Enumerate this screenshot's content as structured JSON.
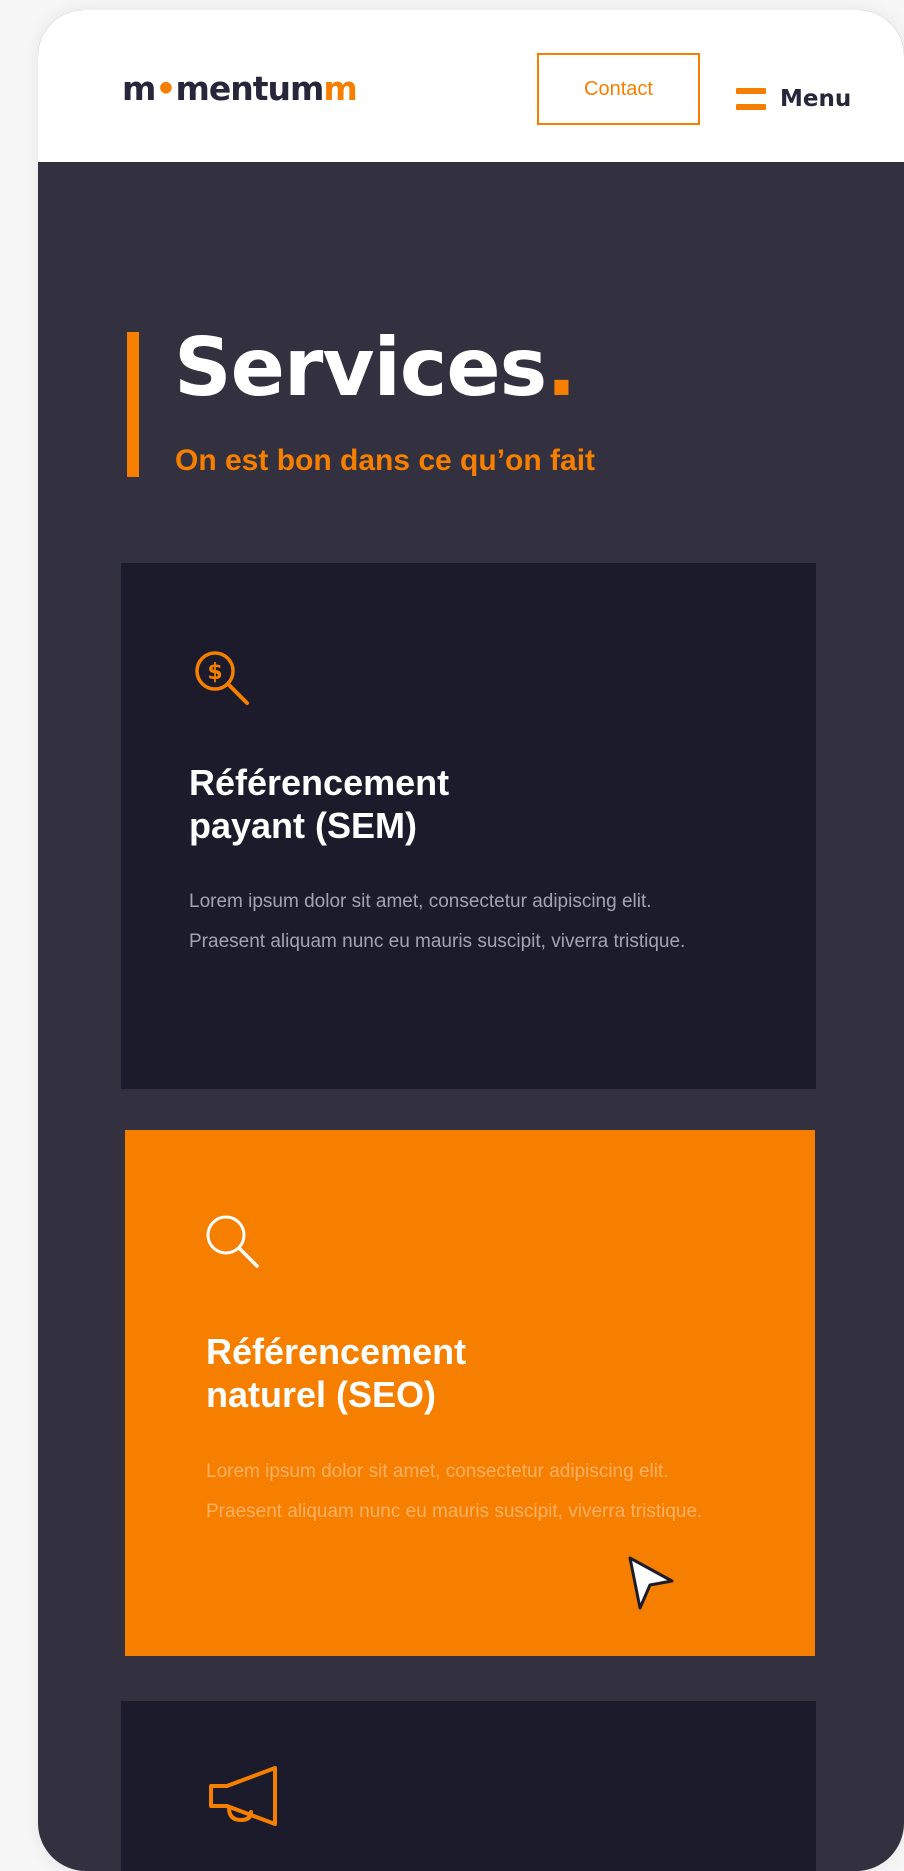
{
  "header": {
    "logo": {
      "part1": "m",
      "part2": "•",
      "part3": "mentum",
      "part4": "m"
    },
    "contact_label": "Contact",
    "menu_label": "Menu"
  },
  "hero": {
    "title": "Services",
    "title_dot": ".",
    "subtitle": "On est bon dans ce qu’on fait"
  },
  "cards": [
    {
      "icon": "dollar-search-icon",
      "title": "Référencement\npayant (SEM)",
      "text": "Lorem ipsum dolor sit amet, consectetur adipiscing elit. Praesent aliquam nunc eu mauris suscipit, viverra tristique."
    },
    {
      "icon": "search-icon",
      "title": "Référencement\nnaturel (SEO)",
      "text": "Lorem ipsum dolor sit amet, consectetur adipiscing elit. Praesent aliquam nunc eu mauris suscipit, viverra tristique."
    },
    {
      "icon": "megaphone-icon"
    }
  ],
  "colors": {
    "accent": "#f77f00",
    "background": "#33313f",
    "card_dark": "#1c1b2b",
    "header": "#ffffff",
    "logo_text": "#26273a"
  }
}
